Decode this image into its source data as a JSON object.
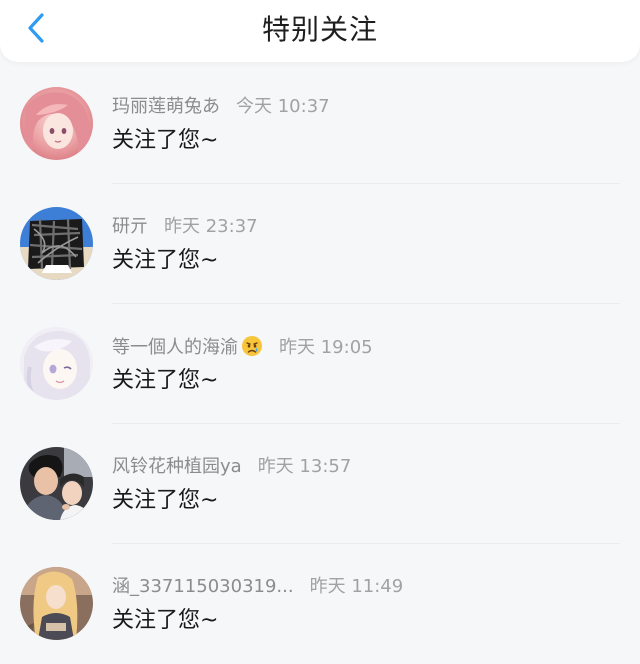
{
  "header": {
    "title": "特别关注",
    "back_icon": "chevron-left-icon",
    "accent": "#2f9bf5"
  },
  "items": [
    {
      "name": "玛丽莲萌兔あ",
      "time": "今天 10:37",
      "message": "关注了您~",
      "avatar": "pink-haired-anime-girl"
    },
    {
      "name": "研亓",
      "time": "昨天 23:37",
      "message": "关注了您~",
      "avatar": "scribbled-photo"
    },
    {
      "name": "等一個人的海渝",
      "time": "昨天 19:05",
      "message": "关注了您~",
      "avatar": "white-haired-anime-girl",
      "emoji": "crying-face-emoji"
    },
    {
      "name": "风铃花种植园ya",
      "time": "昨天 13:57",
      "message": "关注了您~",
      "avatar": "couple-photo"
    },
    {
      "name": "涵_337115030319...",
      "time": "昨天 11:49",
      "message": "关注了您~",
      "avatar": "blonde-anime-girl"
    }
  ]
}
